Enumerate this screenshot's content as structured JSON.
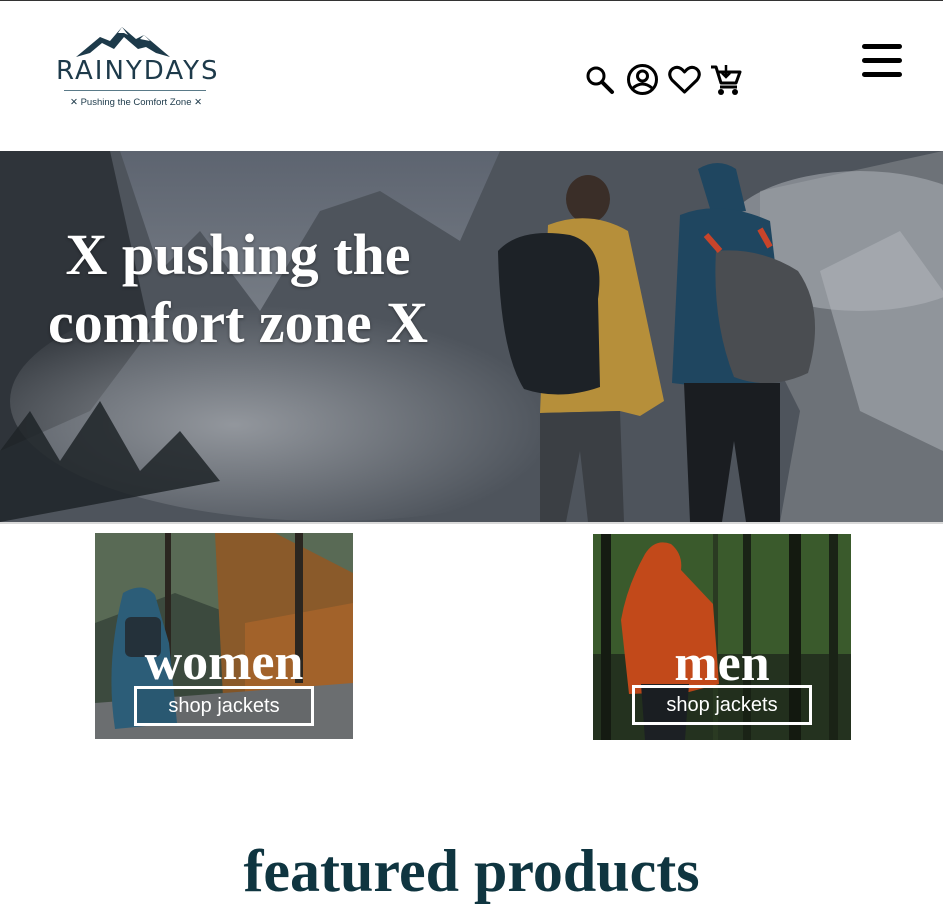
{
  "header": {
    "logo": {
      "wordmark": "RAINYDAYS",
      "tagline": "✕ Pushing the Comfort Zone ✕"
    },
    "icons": [
      "search-icon",
      "account-icon",
      "heart-icon",
      "cart-icon",
      "menu-icon"
    ]
  },
  "hero": {
    "title": "X pushing the comfort zone X"
  },
  "categories": [
    {
      "title": "women",
      "button": "shop jackets"
    },
    {
      "title": "men",
      "button": "shop jackets"
    }
  ],
  "featured": {
    "title": "featured products"
  },
  "colors": {
    "brand": "#0f3540",
    "background": "#ffffff",
    "text_on_image": "#ffffff"
  }
}
